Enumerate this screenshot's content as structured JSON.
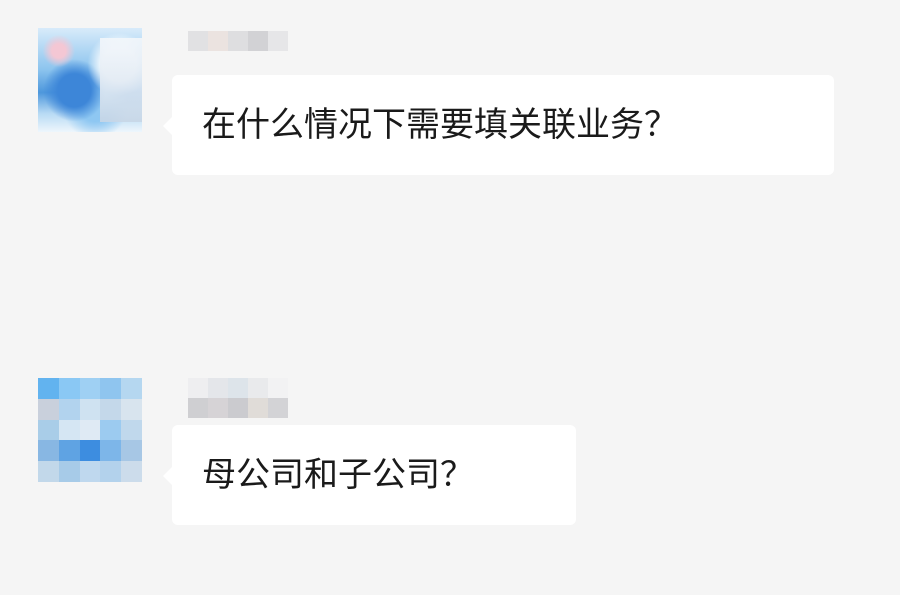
{
  "chat": {
    "messages": [
      {
        "sender_name": "",
        "text": "在什么情况下需要填关联业务？"
      },
      {
        "sender_name": "",
        "text": "母公司和子公司？"
      }
    ]
  },
  "colors": {
    "background": "#f5f5f5",
    "bubble": "#ffffff",
    "text": "#1a1a1a"
  }
}
